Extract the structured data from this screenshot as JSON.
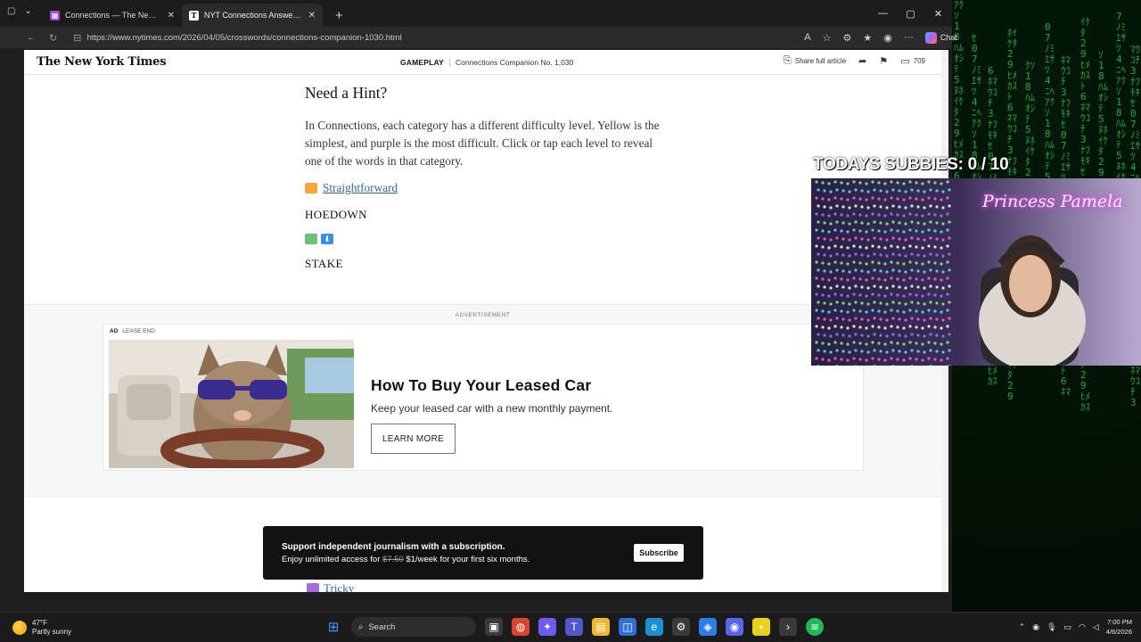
{
  "browser": {
    "tabs": [
      {
        "title": "Connections — The New York Tim",
        "active": false
      },
      {
        "title": "NYT Connections Answers for Ap",
        "active": true
      }
    ],
    "url": "https://www.nytimes.com/2026/04/05/crosswords/connections-companion-1030.html",
    "chat_label": "Chat"
  },
  "page": {
    "header": {
      "logo": "The New York Times",
      "section": "GAMEPLAY",
      "subtitle": "Connections Companion No. 1,030",
      "share_label": "Share full article",
      "comment_count": "709"
    },
    "article": {
      "heading": "Need a Hint?",
      "intro": "In Connections, each category has a different difficulty level. Yellow is the simplest, and purple is the most difficult. Click or tap each level to reveal one of the words in that category.",
      "hint_yellow": "Straightforward",
      "answer_yellow": "HOEDOWN",
      "answer_green": "STAKE",
      "hint_purple": "Tricky"
    },
    "ad": {
      "section_label": "ADVERTISEMENT",
      "badge": "AD",
      "advertiser": "LEASE END",
      "headline": "How To Buy Your Leased Car",
      "description": "Keep your leased car with a new monthly payment.",
      "cta": "LEARN MORE"
    },
    "subscribe_banner": {
      "line1": "Support independent journalism with a subscription.",
      "line2_prefix": "Enjoy unlimited access for ",
      "old_price": "$7.50",
      "line2_suffix": " $1/week for your first six months.",
      "button": "Subscribe"
    }
  },
  "overlay": {
    "subbies": "TODAYS SUBBIES: 0 / 10",
    "streamer_name": "Princess Pamela"
  },
  "taskbar": {
    "weather_temp": "47°F",
    "weather_desc": "Partly sunny",
    "search_label": "Search",
    "time": "7:00 PM",
    "date": "4/6/2026"
  },
  "colors": {
    "link": "#326891",
    "yellow_level": "#f6a63a",
    "green_level": "#6cc27a",
    "purple_level": "#a26be0",
    "matrix_green": "#27c24a"
  }
}
